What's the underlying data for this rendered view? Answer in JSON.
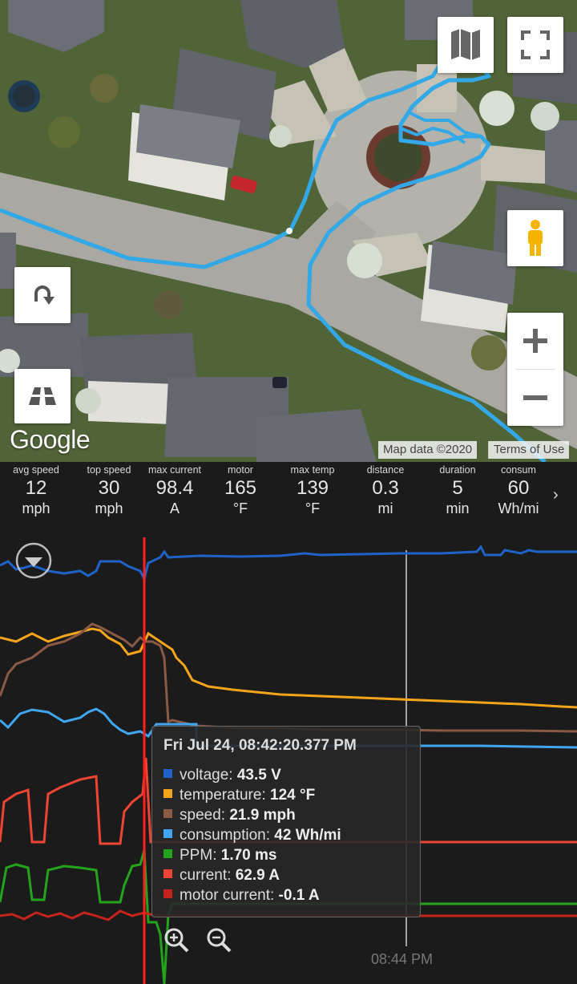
{
  "map": {
    "logo": "Google",
    "attribution": "Map data ©2020",
    "terms": "Terms of Use"
  },
  "stats": [
    {
      "label": "avg speed",
      "value": "12",
      "unit": "mph"
    },
    {
      "label": "top speed",
      "value": "30",
      "unit": "mph"
    },
    {
      "label": "max current",
      "value": "98.4",
      "unit": "A"
    },
    {
      "label": "motor",
      "value": "165",
      "unit": "°F"
    },
    {
      "label": "max temp",
      "value": "139",
      "unit": "°F"
    },
    {
      "label": "distance",
      "value": "0.3",
      "unit": "mi"
    },
    {
      "label": "duration",
      "value": "5",
      "unit": "min"
    },
    {
      "label": "consum",
      "value": "60",
      "unit": "Wh/mi"
    }
  ],
  "chart": {
    "x_tick": "08:44 PM",
    "tooltip": {
      "title": "Fri Jul 24, 08:42:20.377 PM",
      "rows": [
        {
          "name": "voltage",
          "value": "43.5 V",
          "color": "#1f63c9"
        },
        {
          "name": "temperature",
          "value": "124 °F",
          "color": "#f4a51c"
        },
        {
          "name": "speed",
          "value": "21.9 mph",
          "color": "#8a5a44"
        },
        {
          "name": "consumption",
          "value": "42 Wh/mi",
          "color": "#3fa6ef"
        },
        {
          "name": "PPM",
          "value": "1.70 ms",
          "color": "#24a31c"
        },
        {
          "name": "current",
          "value": "62.9 A",
          "color": "#ee4434"
        },
        {
          "name": "motor current",
          "value": "-0.1 A",
          "color": "#c4241c"
        }
      ]
    }
  }
}
